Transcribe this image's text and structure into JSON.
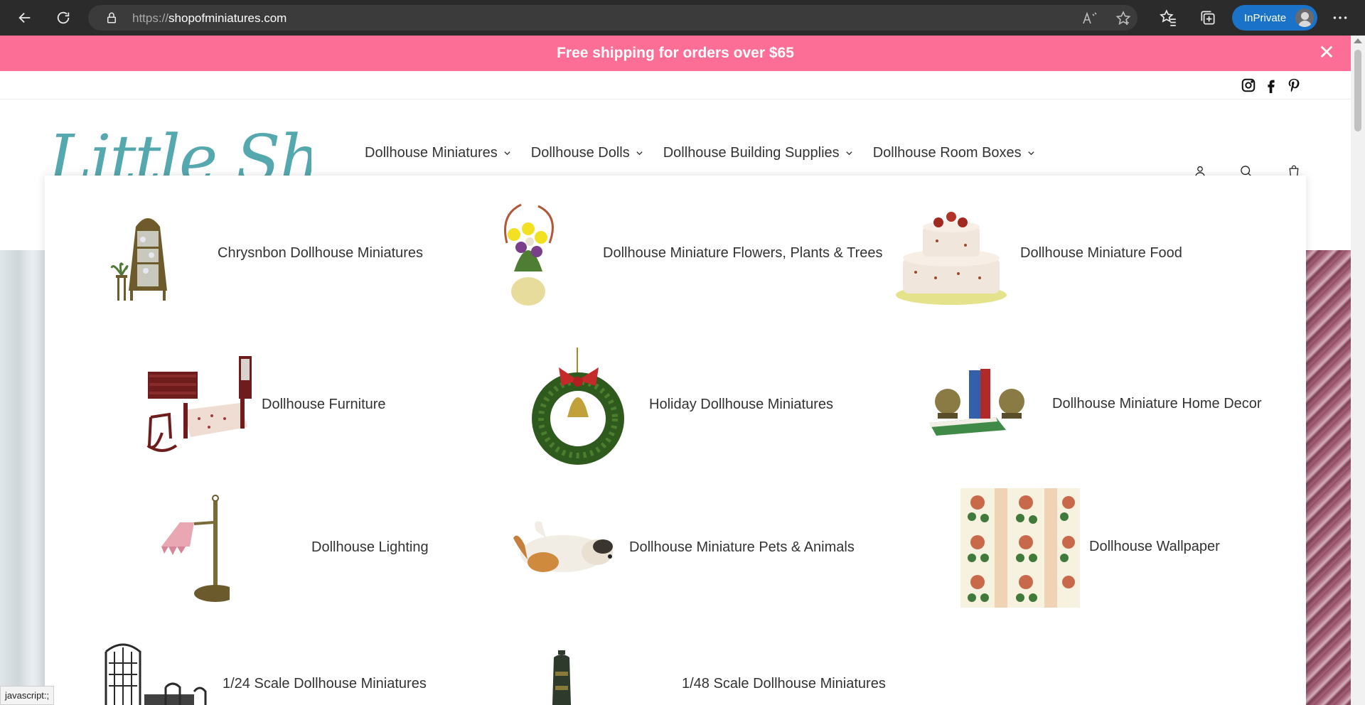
{
  "browser": {
    "url_scheme": "https://",
    "url_host": "shopofminiatures.com",
    "inprivate_label": "InPrivate"
  },
  "promo": {
    "text": "Free shipping for orders over $65",
    "close_glyph": "✕"
  },
  "social": [
    "instagram-icon",
    "facebook-icon",
    "pinterest-icon"
  ],
  "logo": {
    "text": "Little Shop"
  },
  "nav": {
    "items": [
      {
        "label": "Dollhouse Miniatures"
      },
      {
        "label": "Dollhouse Dolls"
      },
      {
        "label": "Dollhouse Building Supplies"
      },
      {
        "label": "Dollhouse Room Boxes"
      }
    ]
  },
  "mega_menu": {
    "items": [
      {
        "label": "Chrysnbon Dollhouse Miniatures",
        "icon": "curio-cabinet-image"
      },
      {
        "label": "Dollhouse Miniature Flowers, Plants & Trees",
        "icon": "flower-pot-image"
      },
      {
        "label": "Dollhouse Miniature Food",
        "icon": "cake-image"
      },
      {
        "label": "Dollhouse Furniture",
        "icon": "bedroom-set-image"
      },
      {
        "label": "Holiday Dollhouse Miniatures",
        "icon": "wreath-image"
      },
      {
        "label": "Dollhouse Miniature Home Decor",
        "icon": "bookends-image"
      },
      {
        "label": "Dollhouse Lighting",
        "icon": "lamp-image"
      },
      {
        "label": "Dollhouse Miniature Pets & Animals",
        "icon": "puppy-image"
      },
      {
        "label": "Dollhouse Wallpaper",
        "icon": "wallpaper-image"
      },
      {
        "label": "1/24 Scale Dollhouse Miniatures",
        "icon": "garden-set-image"
      },
      {
        "label": "1/48 Scale Dollhouse Miniatures",
        "icon": "stove-image"
      }
    ]
  },
  "status_bar": {
    "text": "javascript:;"
  },
  "colors": {
    "promo_bg": "#fc6e95",
    "logo": "#55a8ae",
    "browser_chrome": "#2b2b2b",
    "inprivate": "#1a73c9"
  }
}
